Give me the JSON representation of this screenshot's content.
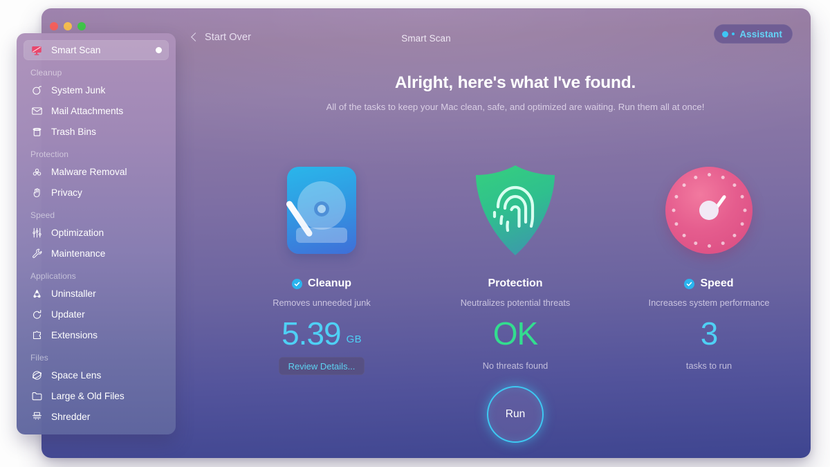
{
  "window": {
    "title": "Smart Scan",
    "back_label": "Start Over",
    "assistant_label": "Assistant",
    "accent_cyan": "#4fd0f5",
    "accent_green": "#33dd8f"
  },
  "sidebar": {
    "primary": {
      "label": "Smart Scan",
      "icon": "smart-scan-monitor-icon",
      "selected": true,
      "has_status_dot": true
    },
    "groups": [
      {
        "title": "Cleanup",
        "items": [
          {
            "label": "System Junk",
            "icon": "vacuum-icon"
          },
          {
            "label": "Mail Attachments",
            "icon": "envelope-icon"
          },
          {
            "label": "Trash Bins",
            "icon": "trash-icon"
          }
        ]
      },
      {
        "title": "Protection",
        "items": [
          {
            "label": "Malware Removal",
            "icon": "biohazard-icon"
          },
          {
            "label": "Privacy",
            "icon": "hand-icon"
          }
        ]
      },
      {
        "title": "Speed",
        "items": [
          {
            "label": "Optimization",
            "icon": "sliders-icon"
          },
          {
            "label": "Maintenance",
            "icon": "wrench-icon"
          }
        ]
      },
      {
        "title": "Applications",
        "items": [
          {
            "label": "Uninstaller",
            "icon": "uninstaller-icon"
          },
          {
            "label": "Updater",
            "icon": "refresh-arrow-icon"
          },
          {
            "label": "Extensions",
            "icon": "puzzle-piece-icon"
          }
        ]
      },
      {
        "title": "Files",
        "items": [
          {
            "label": "Space Lens",
            "icon": "orbit-icon"
          },
          {
            "label": "Large & Old Files",
            "icon": "folder-icon"
          },
          {
            "label": "Shredder",
            "icon": "shredder-icon"
          }
        ]
      }
    ]
  },
  "main": {
    "headline": "Alright, here's what I've found.",
    "subheadline": "All of the tasks to keep your Mac clean, safe, and optimized are waiting. Run them all at once!",
    "cards": [
      {
        "id": "cleanup",
        "title": "Cleanup",
        "checked": true,
        "subtitle": "Removes unneeded junk",
        "value": "5.39",
        "unit": "GB",
        "value_color": "#4fd0f5",
        "footer": "",
        "button": "Review Details...",
        "icon": "hard-drive-icon"
      },
      {
        "id": "protection",
        "title": "Protection",
        "checked": false,
        "subtitle": "Neutralizes potential threats",
        "value": "OK",
        "unit": "",
        "value_color": "#33dd8f",
        "footer": "No threats found",
        "button": "",
        "icon": "shield-fingerprint-icon"
      },
      {
        "id": "speed",
        "title": "Speed",
        "checked": true,
        "subtitle": "Increases system performance",
        "value": "3",
        "unit": "",
        "value_color": "#4fd0f5",
        "footer": "tasks to run",
        "button": "",
        "icon": "speed-gauge-icon"
      }
    ],
    "run_label": "Run"
  }
}
